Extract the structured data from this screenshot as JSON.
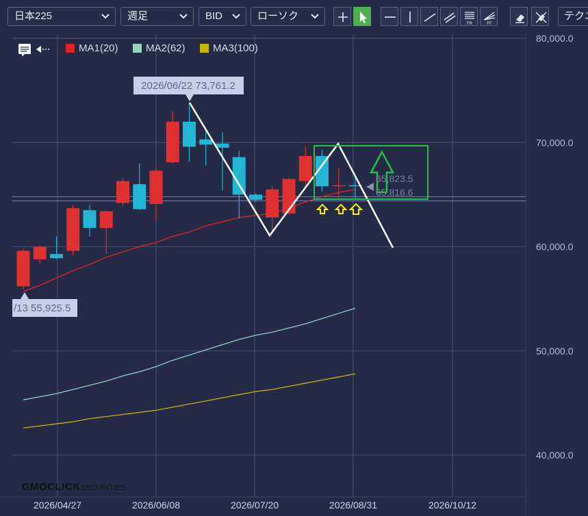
{
  "toolbar": {
    "symbol": "日本225",
    "period": "週足",
    "price_type": "BID",
    "chart_type": "ローソク",
    "technical": "テクニ"
  },
  "legend": [
    {
      "label": "MA1(20)",
      "color": "#e02424"
    },
    {
      "label": "MA2(62)",
      "color": "#8fd5c0"
    },
    {
      "label": "MA3(100)",
      "color": "#c9b400"
    }
  ],
  "colors": {
    "background": "#252a47",
    "up": "#e03030",
    "down": "#22b6d4",
    "grid": "#4a5070",
    "annotation_line": "#ffffff",
    "highlight_box": "#22c04a",
    "arrow_small": "#ffee00"
  },
  "watermark": {
    "brand": "GMOCLICK",
    "suffix": "SECURITIES"
  },
  "chart_data": {
    "type": "candlestick",
    "x_labels": [
      "2026/04/27",
      "2026/06/08",
      "2026/07/20",
      "2026/08/31",
      "2026/10/12"
    ],
    "y_ticks": [
      "80,000.0",
      "70,000.0",
      "60,000.0",
      "50,000.0",
      "40,000.0"
    ],
    "ylim": [
      40000,
      80000
    ],
    "grid": true,
    "candles": [
      {
        "o": 56200,
        "h": 59800,
        "l": 55900,
        "c": 59600
      },
      {
        "o": 58800,
        "h": 60100,
        "l": 58400,
        "c": 60000
      },
      {
        "o": 59300,
        "h": 61000,
        "l": 58800,
        "c": 58900
      },
      {
        "o": 59600,
        "h": 64000,
        "l": 59200,
        "c": 63700
      },
      {
        "o": 63500,
        "h": 64000,
        "l": 61000,
        "c": 61800
      },
      {
        "o": 61800,
        "h": 63500,
        "l": 59300,
        "c": 63400
      },
      {
        "o": 64200,
        "h": 66600,
        "l": 63900,
        "c": 66300
      },
      {
        "o": 66000,
        "h": 68000,
        "l": 63500,
        "c": 63600
      },
      {
        "o": 64100,
        "h": 67500,
        "l": 62400,
        "c": 67300
      },
      {
        "o": 68100,
        "h": 73000,
        "l": 68000,
        "c": 72000
      },
      {
        "o": 72000,
        "h": 73761.2,
        "l": 68200,
        "c": 69600
      },
      {
        "o": 70300,
        "h": 71200,
        "l": 67800,
        "c": 69800
      },
      {
        "o": 69900,
        "h": 71000,
        "l": 65400,
        "c": 69500
      },
      {
        "o": 68600,
        "h": 69200,
        "l": 62700,
        "c": 65000
      },
      {
        "o": 65000,
        "h": 65100,
        "l": 64300,
        "c": 64500
      },
      {
        "o": 62800,
        "h": 65800,
        "l": 61400,
        "c": 65500
      },
      {
        "o": 63200,
        "h": 66600,
        "l": 63100,
        "c": 66500
      },
      {
        "o": 66300,
        "h": 69600,
        "l": 65900,
        "c": 68700
      },
      {
        "o": 68700,
        "h": 69300,
        "l": 65300,
        "c": 65800
      },
      {
        "o": 65900,
        "h": 67500,
        "l": 64700,
        "c": 65900
      },
      {
        "o": 65900,
        "h": 66600,
        "l": 64500,
        "c": 65800
      }
    ],
    "ma1": [
      55700,
      56300,
      57000,
      57700,
      58300,
      59000,
      59500,
      60000,
      60400,
      61000,
      61400,
      62000,
      62400,
      62800,
      63000,
      63200,
      63700,
      64300,
      64800,
      65200,
      65500
    ],
    "ma2": [
      45300,
      45600,
      45900,
      46300,
      46700,
      47100,
      47600,
      48000,
      48500,
      49100,
      49600,
      50100,
      50600,
      51100,
      51500,
      51800,
      52200,
      52600,
      53100,
      53600,
      54100
    ],
    "ma3": [
      42600,
      42800,
      43000,
      43200,
      43500,
      43700,
      43900,
      44100,
      44300,
      44600,
      44900,
      45200,
      45500,
      45800,
      46100,
      46300,
      46600,
      46900,
      47200,
      47500,
      47800
    ],
    "annotations": {
      "high": "2026/06/22 73,761.2",
      "low": "/13 55,925.5",
      "bid": "65,823.5",
      "ask": "65,816.6"
    },
    "h_lines": [
      64800,
      64400
    ]
  }
}
